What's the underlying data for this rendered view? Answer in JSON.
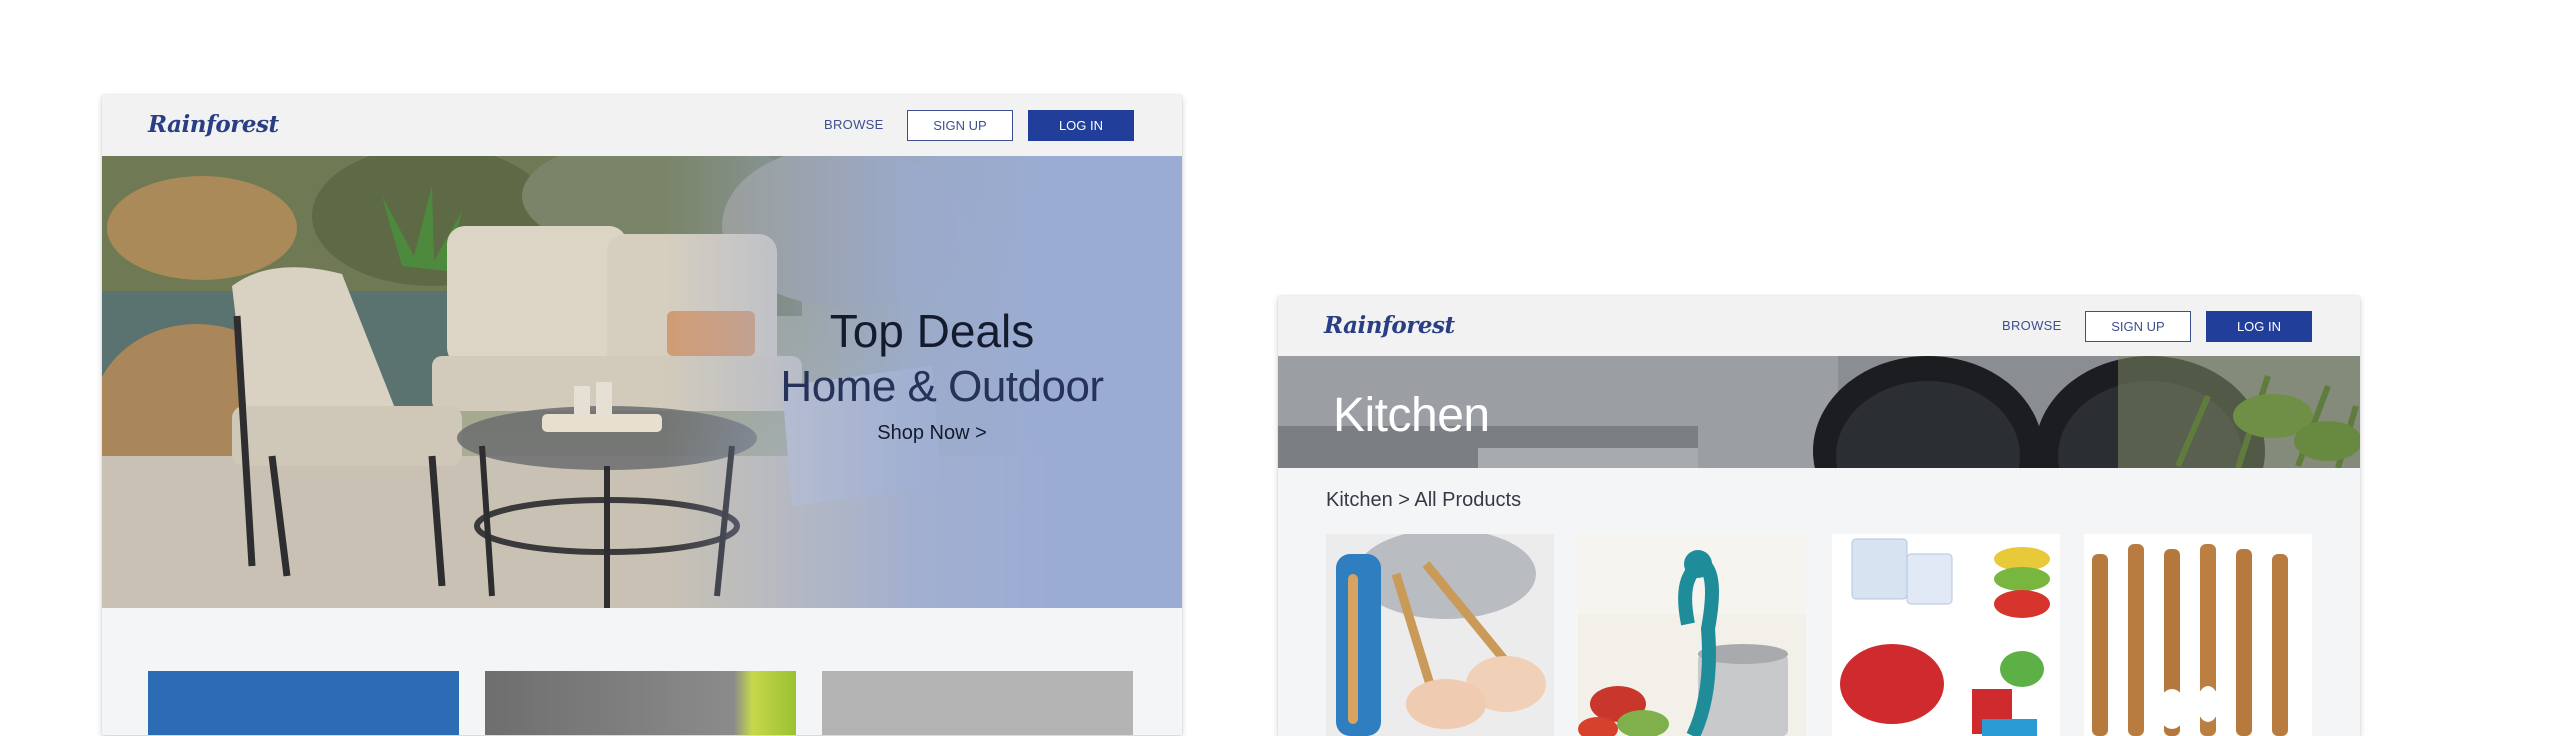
{
  "home": {
    "logo": "Rainforest",
    "nav": {
      "browse": "BROWSE",
      "signup": "SIGN UP",
      "login": "LOG IN"
    },
    "hero": {
      "title": "Top Deals",
      "subtitle": "Home & Outdoor",
      "cta": "Shop Now >"
    }
  },
  "category": {
    "logo": "Rainforest",
    "nav": {
      "browse": "BROWSE",
      "signup": "SIGN UP",
      "login": "LOG IN"
    },
    "banner_title": "Kitchen",
    "breadcrumb": "Kitchen > All Products"
  },
  "colors": {
    "brand": "#213e9a",
    "overlay": "#9bacd4",
    "nav_bg": "#f2f2f3"
  }
}
